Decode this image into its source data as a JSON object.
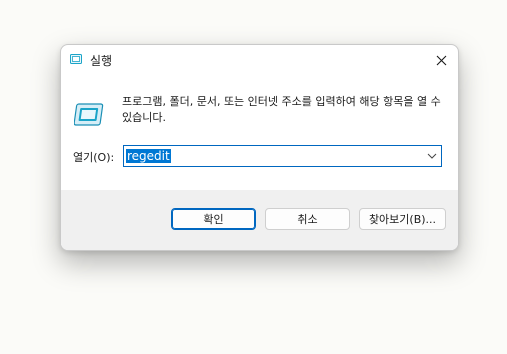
{
  "dialog": {
    "title": "실행",
    "message": "프로그램, 폴더, 문서, 또는 인터넷 주소를 입력하여 해당 항목을 열 수 있습니다.",
    "open_label": "열기(O):",
    "open_value": "regedit",
    "buttons": {
      "ok": "확인",
      "cancel": "취소",
      "browse": "찾아보기(B)..."
    }
  },
  "icons": {
    "title": "run-icon",
    "content": "run-icon",
    "close": "close-icon",
    "dropdown": "chevron-down-icon"
  },
  "colors": {
    "accent": "#0067c0",
    "selection": "#0078d4",
    "footer": "#f0f0f0",
    "icon_teal": "#1aa4c8"
  }
}
